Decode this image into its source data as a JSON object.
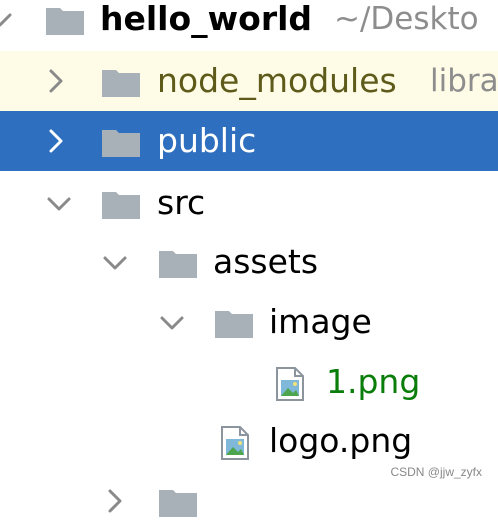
{
  "colors": {
    "selection_bg": "#2f6fbf",
    "library_bg": "#fefbe6",
    "folder_icon": "#a9b1b8",
    "image_file_label": "#0a7d0a",
    "library_label": "#5d5a1a",
    "path_hint": "#8d8d8d"
  },
  "tree": {
    "root": {
      "label": "hello_world",
      "hint": "~/Deskto",
      "icon": "folder-icon",
      "expanded": true
    },
    "node_modules": {
      "label": "node_modules",
      "hint": "libra",
      "icon": "folder-icon",
      "expanded": false
    },
    "public": {
      "label": "public",
      "icon": "folder-icon",
      "expanded": false,
      "selected": true
    },
    "src": {
      "label": "src",
      "icon": "folder-icon",
      "expanded": true
    },
    "assets": {
      "label": "assets",
      "icon": "folder-icon",
      "expanded": true
    },
    "image": {
      "label": "image",
      "icon": "folder-icon",
      "expanded": true
    },
    "file_1png": {
      "label": "1.png",
      "icon": "image-file-icon"
    },
    "logo": {
      "label": "logo.png",
      "icon": "image-file-icon"
    }
  },
  "watermark": "CSDN @jjw_zyfx"
}
